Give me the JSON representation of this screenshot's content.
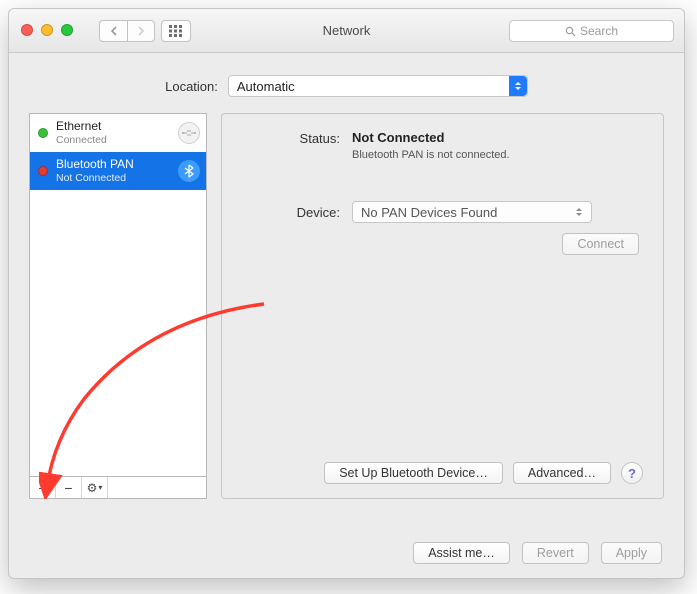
{
  "window": {
    "title": "Network",
    "search_placeholder": "Search"
  },
  "location": {
    "label": "Location:",
    "value": "Automatic"
  },
  "services": [
    {
      "name": "Ethernet",
      "status": "Connected",
      "status_color": "green",
      "icon": "ethernet",
      "selected": false
    },
    {
      "name": "Bluetooth PAN",
      "status": "Not Connected",
      "status_color": "red",
      "icon": "bluetooth",
      "selected": true
    }
  ],
  "sidebar_buttons": {
    "add": "+",
    "remove": "−",
    "gear": "⚙"
  },
  "detail": {
    "status_label": "Status:",
    "status_value": "Not Connected",
    "status_sub": "Bluetooth PAN is not connected.",
    "device_label": "Device:",
    "device_value": "No PAN Devices Found",
    "connect_label": "Connect",
    "setup_label": "Set Up Bluetooth Device…",
    "advanced_label": "Advanced…",
    "help_label": "?"
  },
  "footer": {
    "assist": "Assist me…",
    "revert": "Revert",
    "apply": "Apply"
  }
}
